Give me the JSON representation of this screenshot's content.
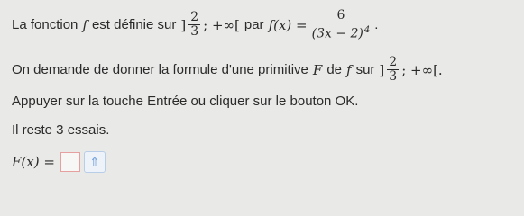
{
  "question": {
    "line1": {
      "intro": "La fonction",
      "func": "f",
      "verb": "est définie sur",
      "interval_open": "]",
      "interval_num": "2",
      "interval_den": "3",
      "interval_rest": "; +∞[",
      "par": "par",
      "f_of_x": "f(x) =",
      "frac_num": "6",
      "frac_den": "(3x − 2)",
      "exponent": "4",
      "end": "."
    },
    "line2": {
      "text": "On demande de donner la formule d'une primitive",
      "F": "F",
      "de": "de",
      "f": "f",
      "sur": "sur",
      "interval_open": "]",
      "interval_num": "2",
      "interval_den": "3",
      "interval_rest": "; +∞[."
    },
    "instructions": "Appuyer sur la touche Entrée ou cliquer sur le bouton OK.",
    "attempts": "Il reste 3 essais."
  },
  "answer": {
    "label": "F(x) =",
    "value": "",
    "keypad_icon": "up-arrow-icon",
    "keypad_glyph": "⇑"
  }
}
